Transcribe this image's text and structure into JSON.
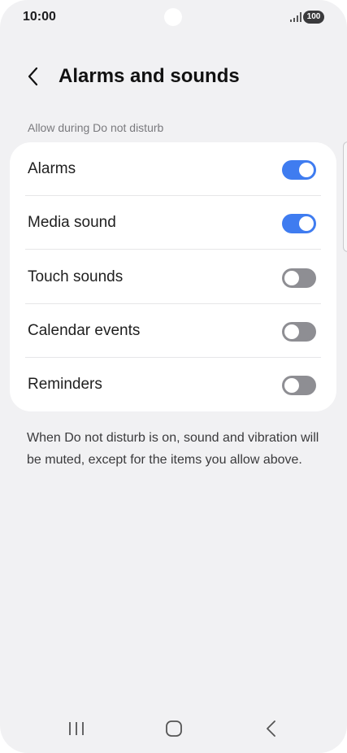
{
  "status_bar": {
    "time": "10:00",
    "battery": "100"
  },
  "header": {
    "title": "Alarms and sounds"
  },
  "section": {
    "label": "Allow during Do not disturb"
  },
  "settings": [
    {
      "label": "Alarms",
      "enabled": true
    },
    {
      "label": "Media sound",
      "enabled": true
    },
    {
      "label": "Touch sounds",
      "enabled": false
    },
    {
      "label": "Calendar events",
      "enabled": false
    },
    {
      "label": "Reminders",
      "enabled": false
    }
  ],
  "description": "When Do not disturb is on, sound and vibration will be muted, except for the items you allow above.",
  "colors": {
    "accent": "#3f7cf0",
    "toggle_off": "#8e8e93",
    "background": "#f1f1f3",
    "card": "#ffffff"
  },
  "icons": {
    "back": "chevron-left-icon",
    "nav_recents": "recents-icon",
    "nav_home": "home-icon",
    "nav_back": "back-icon"
  }
}
